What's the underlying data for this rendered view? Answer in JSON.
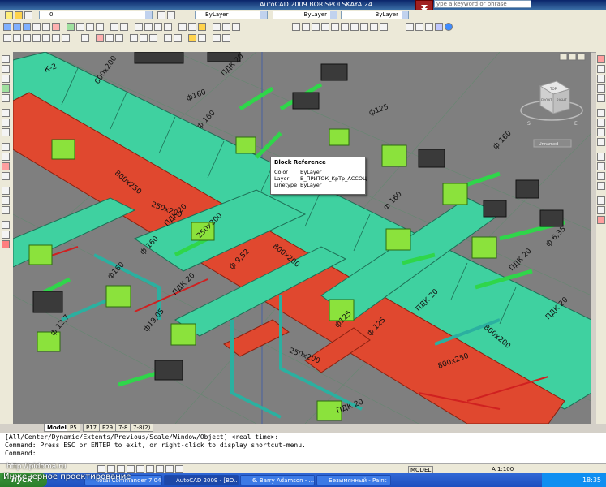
{
  "app": {
    "title": "AutoCAD 2009 BORISPOLSKAYA 24",
    "help_placeholder": "ype a keyword or phrase"
  },
  "toolbar": {
    "layer_value": "0",
    "color_value": "ByLayer",
    "linetype_value": "ByLayer",
    "lineweight_value": "ByLayer"
  },
  "viewcube": {
    "top": "TOP",
    "front": "FRONT",
    "right": "RIGHT",
    "south": "S",
    "east": "E",
    "ucs_label": "Unnamed"
  },
  "tooltip": {
    "title": "Block Reference",
    "rows": [
      {
        "key": "Color",
        "value": "ByLayer"
      },
      {
        "key": "Layer",
        "value": "В_ПРИТОК_КрТр_ACCOЦ"
      },
      {
        "key": "Linetype",
        "value": "ByLayer"
      }
    ]
  },
  "drawing_labels": [
    "ПДК 20",
    "К-2",
    "600x200",
    "ф160",
    "ф125",
    "ф 160",
    "800x250",
    "250x200",
    "ПДК 20",
    "ф 9,52",
    "ф 160",
    "800x200",
    "250x200",
    "ф 12,7",
    "ф19,05",
    "ПДК 20",
    "ф160",
    "ф 160",
    "800x200",
    "ПДК 20",
    "ф 6,35",
    "ПДК 20",
    "ф 160",
    "250x200",
    "ф125",
    "ПДК 20",
    "800x250",
    "ф 125",
    "ПДК 20"
  ],
  "layout_tabs": [
    "Model",
    "P5",
    "P17",
    "P29",
    "7-8",
    "7-8(2)"
  ],
  "command_history": [
    "[All/Center/Dynamic/Extents/Previous/Scale/Window/Object] <real time>:",
    "Command: Press ESC or ENTER to exit, or right-click to display shortcut-menu.",
    "",
    "Command:"
  ],
  "status": {
    "model": "MODEL",
    "scale": "A 1:100"
  },
  "taskbar": {
    "start": "пуск",
    "tasks": [
      "Total Commander 7.04...",
      "AutoCAD 2009 - [BO...",
      "6. Barry Adamson - ...",
      "Безымянный - Paint"
    ],
    "clock": "18:35"
  },
  "watermark": {
    "line1": "http://pidoma.ru",
    "line2": "Инженерное проектирование"
  },
  "colors": {
    "viewport_bg": "#7f7f7f",
    "duct_supply": "#e0482f",
    "duct_cyan": "#3fd1a0",
    "pipe_green": "#2fd64a",
    "box_green": "#8be23c",
    "box_dark": "#3a3a3a",
    "taskbar": "#245edb"
  }
}
